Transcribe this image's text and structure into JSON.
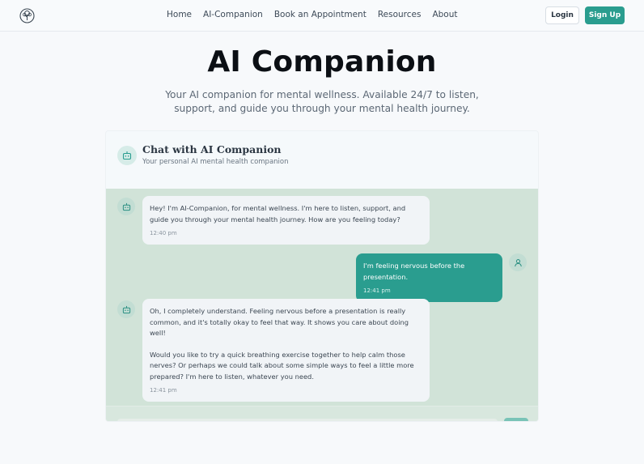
{
  "header": {
    "nav": [
      "Home",
      "AI-Companion",
      "Book an Appointment",
      "Resources",
      "About"
    ],
    "login_label": "Login",
    "signup_label": "Sign Up",
    "logo_icon": "tree-icon"
  },
  "hero": {
    "title": "AI Companion",
    "subtitle": "Your AI companion for mental wellness. Available 24/7 to listen, support, and guide you through your mental health journey."
  },
  "chat": {
    "title": "Chat with AI Companion",
    "subtitle": "Your personal AI mental health companion",
    "messages": [
      {
        "role": "bot",
        "text": "Hey! I'm AI-Companion, for mental wellness. I'm here to listen, support, and guide you through your mental health journey. How are you feeling today?",
        "time": "12:40 pm"
      },
      {
        "role": "user",
        "text": "I'm feeling nervous before the presentation.",
        "time": "12:41 pm"
      },
      {
        "role": "bot",
        "text_p1": "Oh, I completely understand. Feeling nervous before a presentation is really common, and it's totally okay to feel that way. It shows you care about doing well!",
        "text_p2": "Would you like to try a quick breathing exercise together to help calm those nerves? Or perhaps we could talk about some simple ways to feel a little more prepared? I'm here to listen, whatever you need.",
        "time": "12:41 pm"
      }
    ]
  },
  "colors": {
    "accent": "#2a9d8f",
    "chat_background": "#d1e3d8",
    "bot_bubble": "#f1f4f7"
  }
}
